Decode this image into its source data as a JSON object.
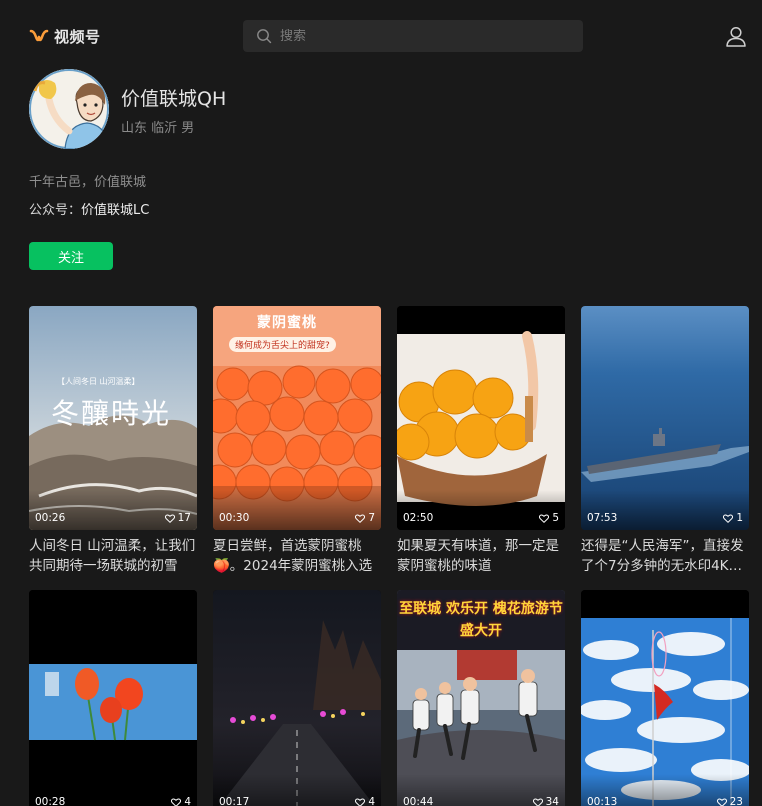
{
  "header": {
    "app_name": "视频号",
    "search_placeholder": "搜索"
  },
  "profile": {
    "name": "价值联城QH",
    "location": "山东 临沂 男",
    "bio": "千年古邑，价值联城",
    "gzh_label": "公众号：",
    "gzh_value": "价值联城LC",
    "follow_label": "关注"
  },
  "colors": {
    "background": "#191919",
    "accent": "#07c160",
    "logo": "#fa9d3b"
  },
  "videos": [
    {
      "duration": "00:26",
      "likes": "17",
      "title": "人间冬日 山河温柔，让我们共同期待一场联城的初雪",
      "thumb_text": "冬釀時光",
      "thumb_sub": "【人间冬日 山河温柔】"
    },
    {
      "duration": "00:30",
      "likes": "7",
      "title": "夏日尝鲜，首选蒙阴蜜桃🍑。2024年蒙阴蜜桃入选",
      "thumb_text": "蒙阴蜜桃",
      "thumb_sub": "缘何成为舌尖上的甜宠?"
    },
    {
      "duration": "02:50",
      "likes": "5",
      "title": "如果夏天有味道，那一定是蒙阴蜜桃的味道",
      "thumb_text": "",
      "thumb_sub": ""
    },
    {
      "duration": "07:53",
      "likes": "1",
      "title": "还得是“人民海军”，直接发了个7分多钟的无水印4K高清",
      "thumb_text": "",
      "thumb_sub": ""
    },
    {
      "duration": "00:28",
      "likes": "4",
      "title": "",
      "thumb_text": "",
      "thumb_sub": ""
    },
    {
      "duration": "00:17",
      "likes": "4",
      "title": "",
      "thumb_text": "",
      "thumb_sub": ""
    },
    {
      "duration": "00:44",
      "likes": "34",
      "title": "",
      "thumb_text": "至联城 欢乐开 槐花旅游节盛大开",
      "thumb_sub": ""
    },
    {
      "duration": "00:13",
      "likes": "23",
      "title": "",
      "thumb_text": "",
      "thumb_sub": ""
    }
  ]
}
